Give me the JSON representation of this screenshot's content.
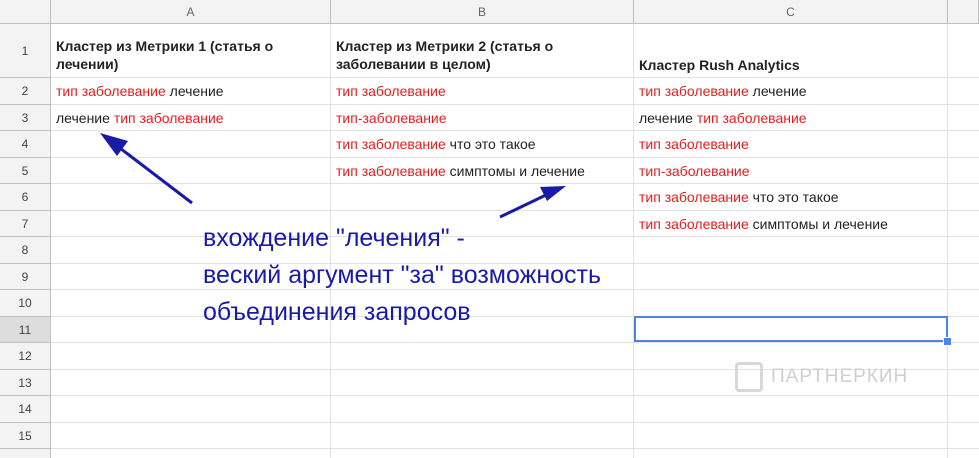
{
  "columns": [
    "A",
    "B",
    "C"
  ],
  "rows": [
    "1",
    "2",
    "3",
    "4",
    "5",
    "6",
    "7",
    "8",
    "9",
    "10",
    "11",
    "12",
    "13",
    "14",
    "15"
  ],
  "cells": {
    "A1": "Кластер из Метрики 1 (статья о лечении)",
    "B1": "Кластер из Метрики 2 (статья о заболевании в целом)",
    "C1": "Кластер Rush Analytics",
    "A2_red": "тип заболевание",
    "A2_black": " лечение",
    "A3_black": "лечение ",
    "A3_red": "тип заболевание",
    "B2_red": "тип заболевание",
    "B3_red": "тип-заболевание",
    "B4_red": "тип заболевание",
    "B4_black": " что это такое",
    "B5_red": "тип заболевание",
    "B5_black": " симптомы и лечение",
    "C2_red": "тип заболевание",
    "C2_black": " лечение",
    "C3_black": "лечение ",
    "C3_red": "тип заболевание",
    "C4_red": "тип заболевание",
    "C5_red": "тип-заболевание",
    "C6_red": "тип заболевание",
    "C6_black": " что это такое",
    "C7_red": "тип заболевание",
    "C7_black": " симптомы и лечение"
  },
  "annotation": {
    "line1": "вхождение \"лечения\" -",
    "line2": "веский аргумент \"за\" возможность",
    "line3": "объединения запросов"
  },
  "watermark": "ПАРТНЕРКИН",
  "colors": {
    "red_text": "#e02020",
    "annotation": "#1a1aa8",
    "selection": "#4a86e8"
  }
}
